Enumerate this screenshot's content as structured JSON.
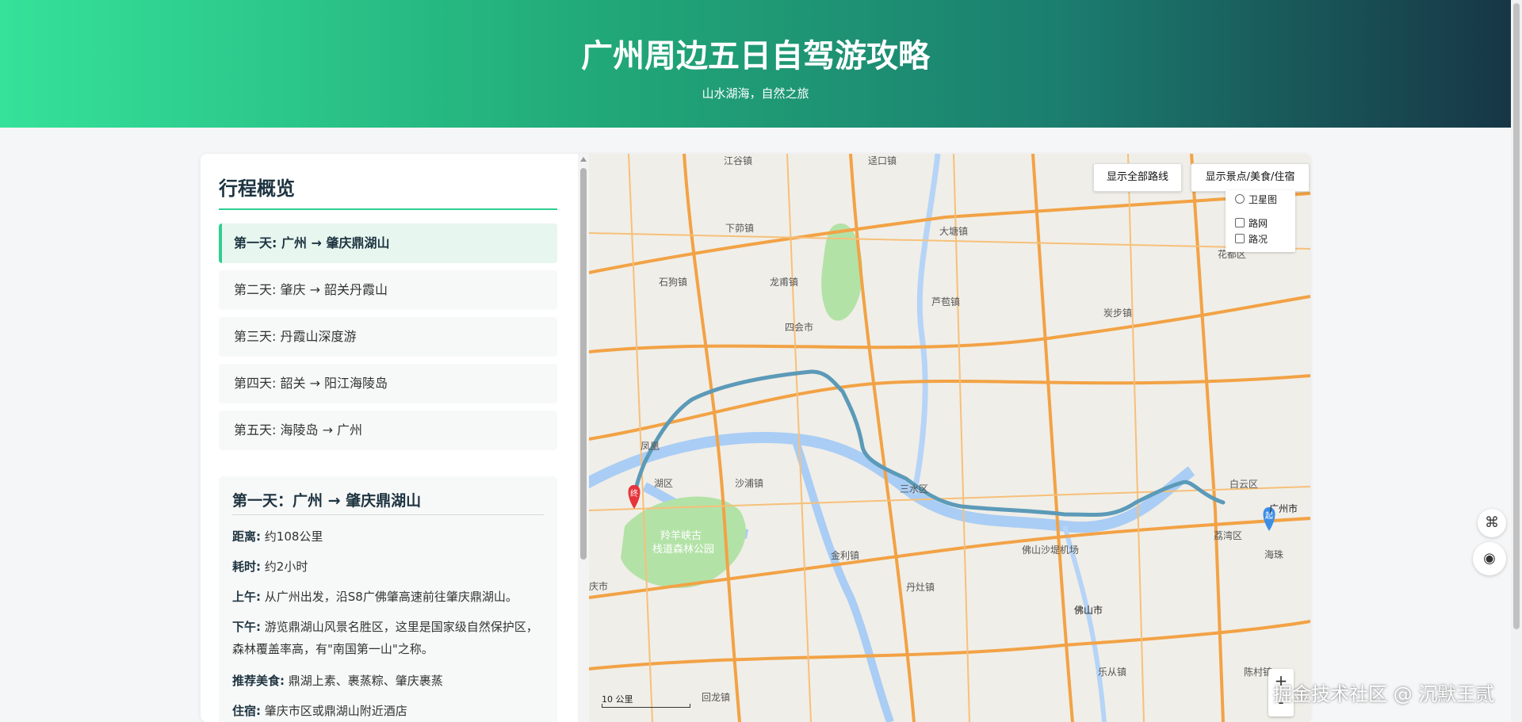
{
  "header": {
    "title": "广州周边五日自驾游攻略",
    "subtitle": "山水湖海，自然之旅"
  },
  "overview": {
    "title": "行程概览",
    "days": [
      {
        "label": "第一天: 广州 → 肇庆鼎湖山",
        "active": true
      },
      {
        "label": "第二天: 肇庆 → 韶关丹霞山",
        "active": false
      },
      {
        "label": "第三天: 丹霞山深度游",
        "active": false
      },
      {
        "label": "第四天: 韶关 → 阳江海陵岛",
        "active": false
      },
      {
        "label": "第五天: 海陵岛 → 广州",
        "active": false
      }
    ]
  },
  "detail": {
    "title": "第一天：广州 → 肇庆鼎湖山",
    "distance_label": "距离:",
    "distance_value": "约108公里",
    "duration_label": "耗时:",
    "duration_value": "约2小时",
    "morning_label": "上午:",
    "morning_value": "从广州出发，沿S8广佛肇高速前往肇庆鼎湖山。",
    "afternoon_label": "下午:",
    "afternoon_value": "游览鼎湖山风景名胜区，这里是国家级自然保护区，森林覆盖率高，有\"南国第一山\"之称。",
    "food_label": "推荐美食:",
    "food_value": "鼎湖上素、裹蒸粽、肇庆裹蒸",
    "stay_label": "住宿:",
    "stay_value": "肇庆市区或鼎湖山附近酒店"
  },
  "map": {
    "btn_routes": "显示全部路线",
    "btn_poi": "显示景点/美食/住宿",
    "layer_satellite": "卫星图",
    "layer_roads": "路网",
    "layer_traffic": "路况",
    "zoom_in": "+",
    "zoom_out": "-",
    "scale": "10 公里",
    "start_marker": "起",
    "end_marker": "终",
    "route_color": "#5b9ab8",
    "labels": [
      "江谷镇",
      "迳口镇",
      "下茆镇",
      "大塘镇",
      "石狗镇",
      "龙甫镇",
      "芦苞镇",
      "花都区",
      "四会市",
      "炭步镇",
      "凤凰",
      "湖区",
      "沙浦镇",
      "三水区",
      "白云区",
      "广州市",
      "荔湾区",
      "海珠",
      "羚羊峡古",
      "栈道森林公园",
      "佛山沙堤机场",
      "金利镇",
      "丹灶镇",
      "佛山市",
      "乐从镇",
      "陈村镇",
      "回龙镇",
      "庆市"
    ]
  },
  "watermark": "掘金技术社区 @ 沉默王贰"
}
